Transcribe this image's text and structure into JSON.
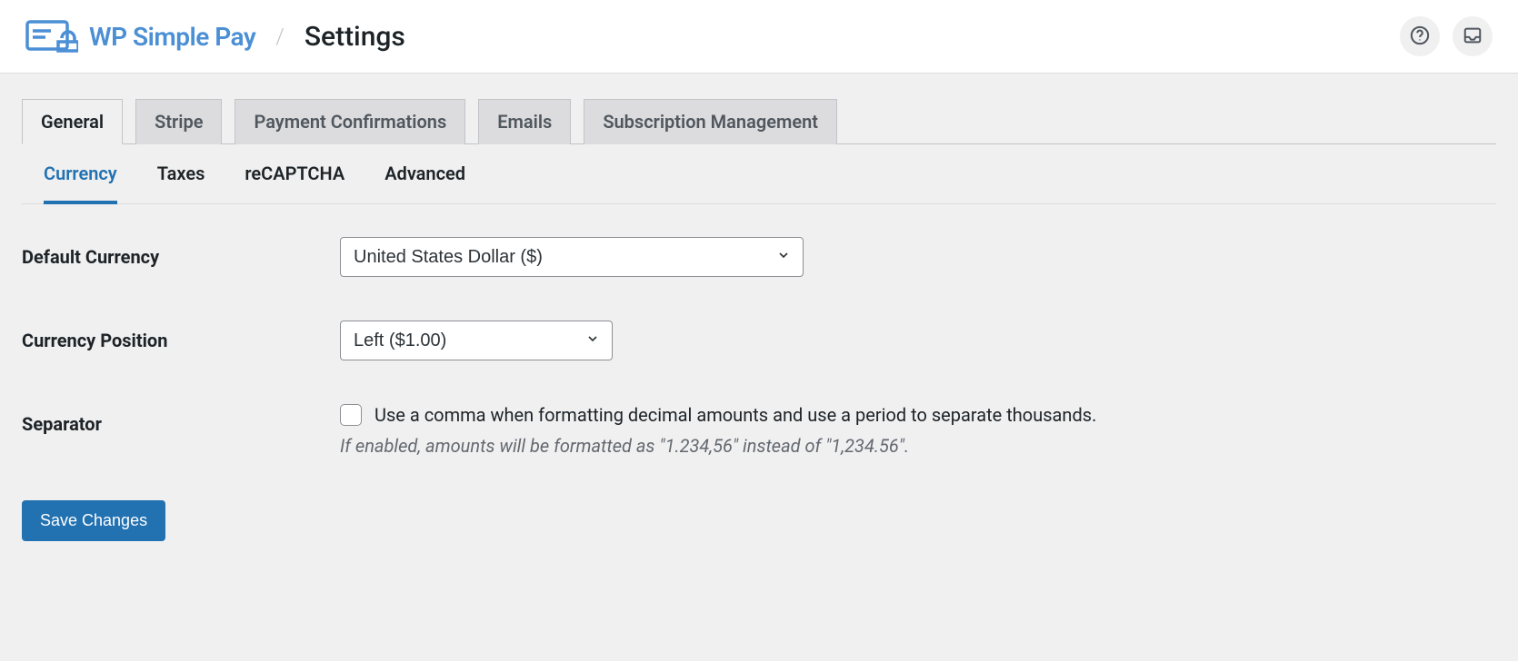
{
  "header": {
    "brand": "WP Simple Pay",
    "title": "Settings"
  },
  "tabs": [
    {
      "label": "General"
    },
    {
      "label": "Stripe"
    },
    {
      "label": "Payment Confirmations"
    },
    {
      "label": "Emails"
    },
    {
      "label": "Subscription Management"
    }
  ],
  "subtabs": [
    {
      "label": "Currency"
    },
    {
      "label": "Taxes"
    },
    {
      "label": "reCAPTCHA"
    },
    {
      "label": "Advanced"
    }
  ],
  "form": {
    "default_currency": {
      "label": "Default Currency",
      "value": "United States Dollar ($)"
    },
    "currency_position": {
      "label": "Currency Position",
      "value": "Left ($1.00)"
    },
    "separator": {
      "label": "Separator",
      "checkbox_label": "Use a comma when formatting decimal amounts and use a period to separate thousands.",
      "help": "If enabled, amounts will be formatted as \"1.234,56\" instead of \"1,234.56\"."
    },
    "save_button": "Save Changes"
  }
}
